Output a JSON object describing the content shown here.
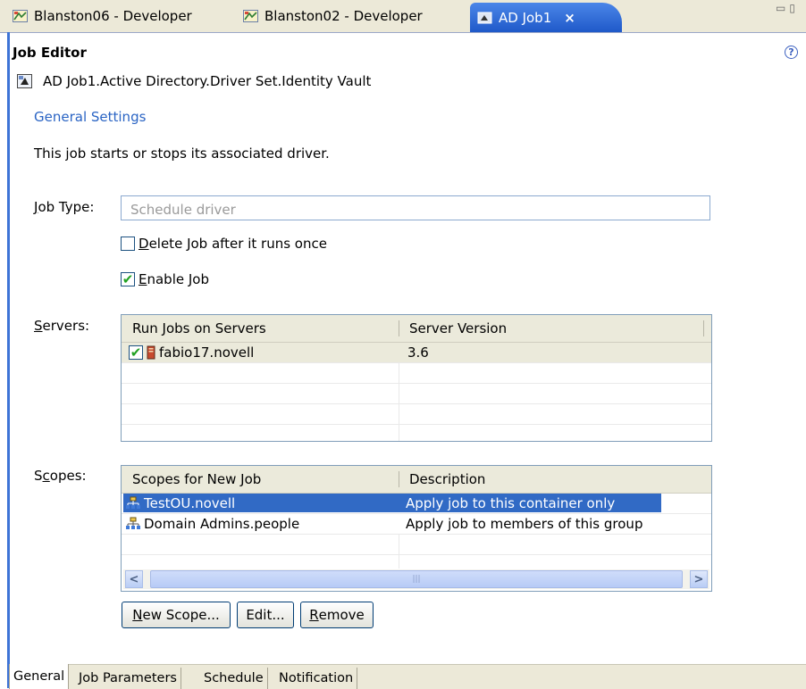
{
  "tabs": [
    {
      "label": "Blanston06 - Developer",
      "icon": "developer-icon"
    },
    {
      "label": "Blanston02 - Developer",
      "icon": "developer-icon"
    },
    {
      "label": "AD Job1",
      "icon": "job-icon",
      "active": true
    }
  ],
  "active_tab_close": "×",
  "editor": {
    "title": "Job Editor",
    "help": "?",
    "object_path": "AD Job1.Active Directory.Driver Set.Identity Vault",
    "section_heading": "General Settings",
    "description": "This job starts or stops its associated driver."
  },
  "job_type": {
    "label_accel": "J",
    "label_rest": "ob Type:",
    "value": "Schedule driver"
  },
  "delete_job": {
    "accel": "D",
    "rest": "elete Job after it runs once",
    "checked": false
  },
  "enable_job": {
    "accel": "E",
    "rest": "nable Job",
    "checked": true
  },
  "servers": {
    "label_accel": "S",
    "label_rest": "ervers:",
    "columns": [
      "Run Jobs on Servers",
      "Server Version"
    ],
    "rows": [
      {
        "name": "fabio17.novell",
        "version": "3.6",
        "checked": true
      }
    ]
  },
  "scopes": {
    "label_pre": "S",
    "label_accel": "c",
    "label_rest": "opes:",
    "columns": [
      "Scopes for New Job",
      "Description"
    ],
    "rows": [
      {
        "name": "TestOU.novell",
        "description": "Apply job to this container only",
        "selected": true
      },
      {
        "name": "Domain Admins.people",
        "description": "Apply job to members of this group",
        "selected": false
      }
    ]
  },
  "buttons": {
    "new_accel": "N",
    "new_rest": "ew Scope...",
    "edit": "Edit...",
    "remove_accel": "R",
    "remove_rest": "emove"
  },
  "bottom_tabs": [
    "General",
    "Job Parameters",
    "Schedule",
    "Notification"
  ],
  "colors": {
    "accent": "#316ac5",
    "link": "#2a64c4",
    "check": "#21a121"
  }
}
